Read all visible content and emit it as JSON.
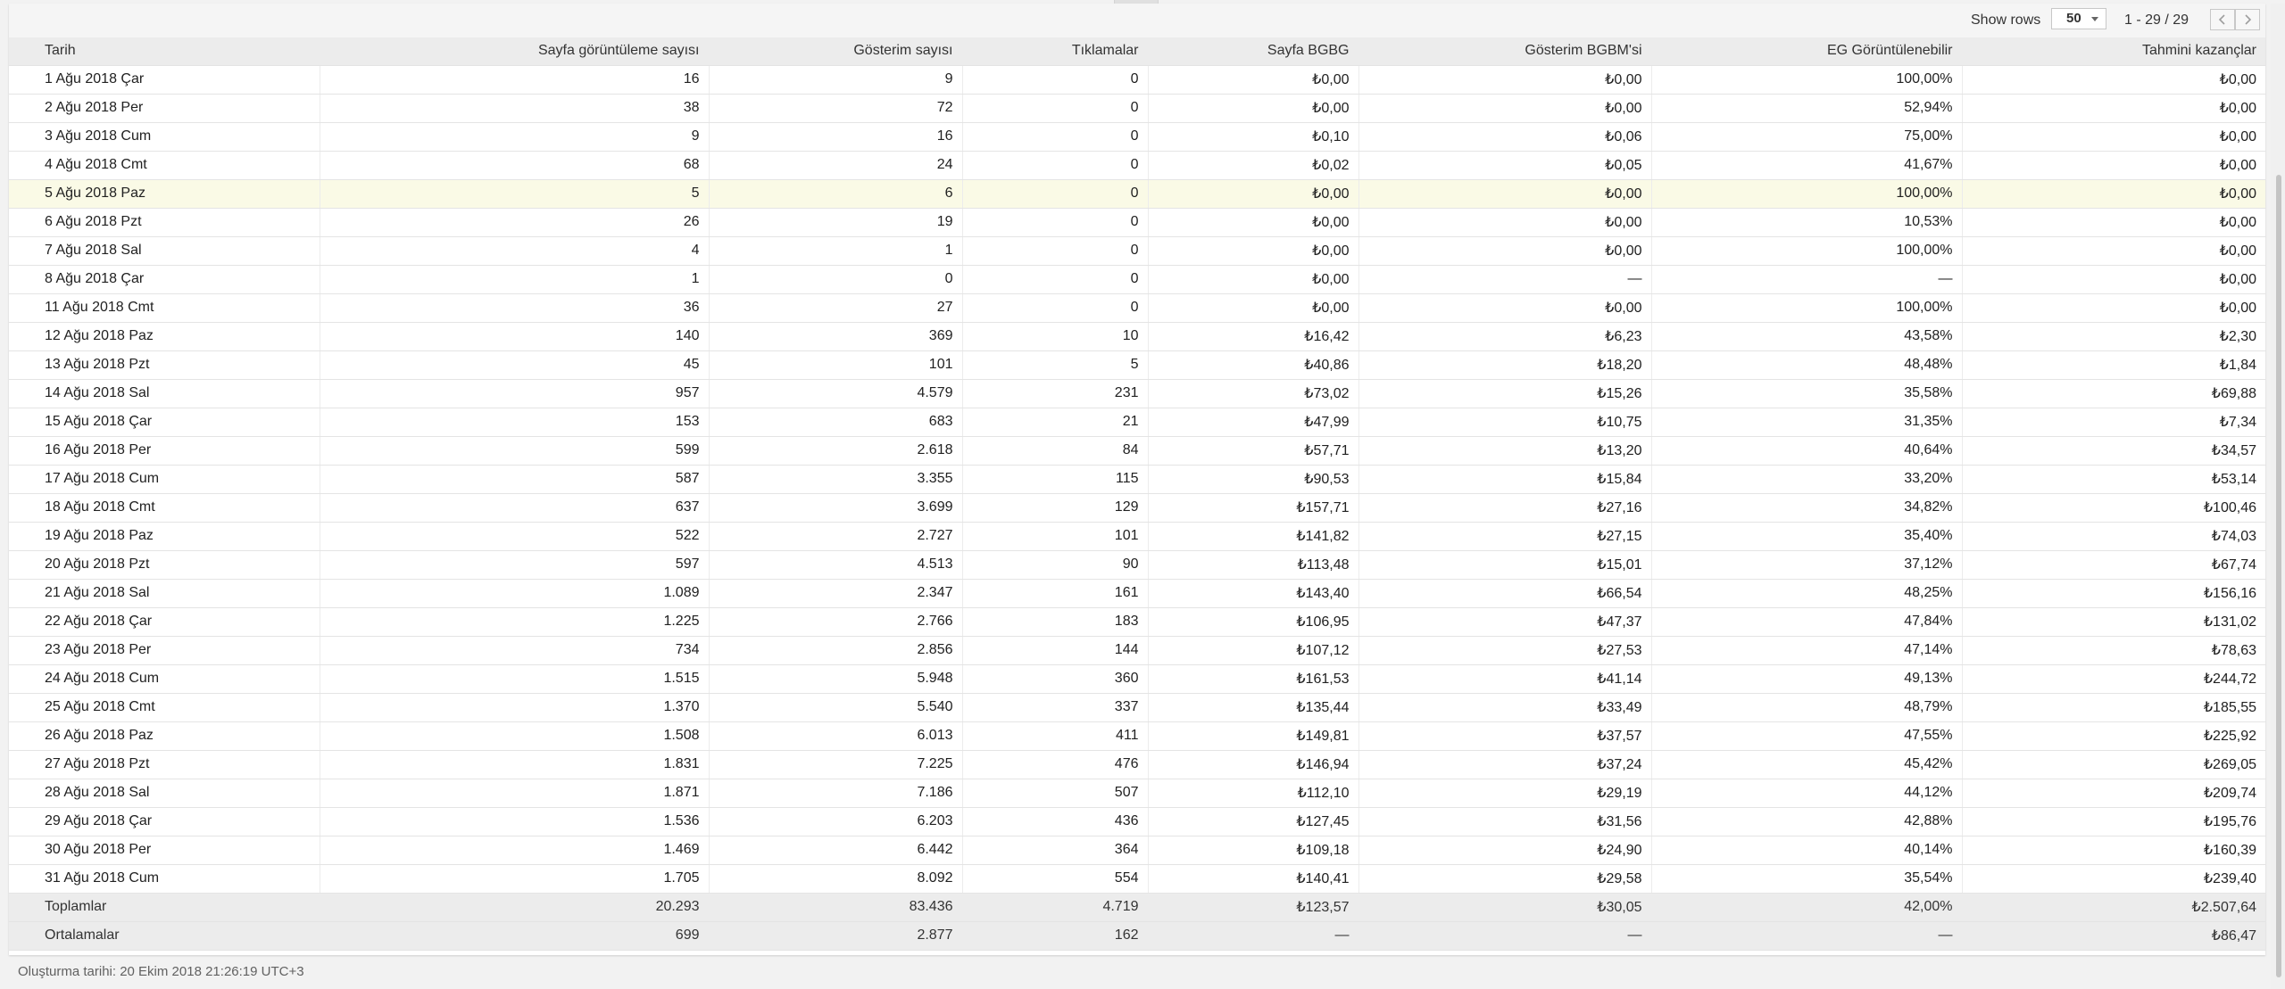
{
  "toolbar": {
    "show_rows_label": "Show rows",
    "rows_value": "50",
    "range": "1 - 29 / 29"
  },
  "columns": [
    "Tarih",
    "Sayfa görüntüleme sayısı",
    "Gösterim sayısı",
    "Tıklamalar",
    "Sayfa BGBG",
    "Gösterim BGBM'si",
    "EG Görüntülenebilir",
    "Tahmini kazançlar"
  ],
  "rows": [
    [
      "1 Ağu 2018 Çar",
      "16",
      "9",
      "0",
      "₺0,00",
      "₺0,00",
      "100,00%",
      "₺0,00"
    ],
    [
      "2 Ağu 2018 Per",
      "38",
      "72",
      "0",
      "₺0,00",
      "₺0,00",
      "52,94%",
      "₺0,00"
    ],
    [
      "3 Ağu 2018 Cum",
      "9",
      "16",
      "0",
      "₺0,10",
      "₺0,06",
      "75,00%",
      "₺0,00"
    ],
    [
      "4 Ağu 2018 Cmt",
      "68",
      "24",
      "0",
      "₺0,02",
      "₺0,05",
      "41,67%",
      "₺0,00"
    ],
    [
      "5 Ağu 2018 Paz",
      "5",
      "6",
      "0",
      "₺0,00",
      "₺0,00",
      "100,00%",
      "₺0,00"
    ],
    [
      "6 Ağu 2018 Pzt",
      "26",
      "19",
      "0",
      "₺0,00",
      "₺0,00",
      "10,53%",
      "₺0,00"
    ],
    [
      "7 Ağu 2018 Sal",
      "4",
      "1",
      "0",
      "₺0,00",
      "₺0,00",
      "100,00%",
      "₺0,00"
    ],
    [
      "8 Ağu 2018 Çar",
      "1",
      "0",
      "0",
      "₺0,00",
      "—",
      "—",
      "₺0,00"
    ],
    [
      "11 Ağu 2018 Cmt",
      "36",
      "27",
      "0",
      "₺0,00",
      "₺0,00",
      "100,00%",
      "₺0,00"
    ],
    [
      "12 Ağu 2018 Paz",
      "140",
      "369",
      "10",
      "₺16,42",
      "₺6,23",
      "43,58%",
      "₺2,30"
    ],
    [
      "13 Ağu 2018 Pzt",
      "45",
      "101",
      "5",
      "₺40,86",
      "₺18,20",
      "48,48%",
      "₺1,84"
    ],
    [
      "14 Ağu 2018 Sal",
      "957",
      "4.579",
      "231",
      "₺73,02",
      "₺15,26",
      "35,58%",
      "₺69,88"
    ],
    [
      "15 Ağu 2018 Çar",
      "153",
      "683",
      "21",
      "₺47,99",
      "₺10,75",
      "31,35%",
      "₺7,34"
    ],
    [
      "16 Ağu 2018 Per",
      "599",
      "2.618",
      "84",
      "₺57,71",
      "₺13,20",
      "40,64%",
      "₺34,57"
    ],
    [
      "17 Ağu 2018 Cum",
      "587",
      "3.355",
      "115",
      "₺90,53",
      "₺15,84",
      "33,20%",
      "₺53,14"
    ],
    [
      "18 Ağu 2018 Cmt",
      "637",
      "3.699",
      "129",
      "₺157,71",
      "₺27,16",
      "34,82%",
      "₺100,46"
    ],
    [
      "19 Ağu 2018 Paz",
      "522",
      "2.727",
      "101",
      "₺141,82",
      "₺27,15",
      "35,40%",
      "₺74,03"
    ],
    [
      "20 Ağu 2018 Pzt",
      "597",
      "4.513",
      "90",
      "₺113,48",
      "₺15,01",
      "37,12%",
      "₺67,74"
    ],
    [
      "21 Ağu 2018 Sal",
      "1.089",
      "2.347",
      "161",
      "₺143,40",
      "₺66,54",
      "48,25%",
      "₺156,16"
    ],
    [
      "22 Ağu 2018 Çar",
      "1.225",
      "2.766",
      "183",
      "₺106,95",
      "₺47,37",
      "47,84%",
      "₺131,02"
    ],
    [
      "23 Ağu 2018 Per",
      "734",
      "2.856",
      "144",
      "₺107,12",
      "₺27,53",
      "47,14%",
      "₺78,63"
    ],
    [
      "24 Ağu 2018 Cum",
      "1.515",
      "5.948",
      "360",
      "₺161,53",
      "₺41,14",
      "49,13%",
      "₺244,72"
    ],
    [
      "25 Ağu 2018 Cmt",
      "1.370",
      "5.540",
      "337",
      "₺135,44",
      "₺33,49",
      "48,79%",
      "₺185,55"
    ],
    [
      "26 Ağu 2018 Paz",
      "1.508",
      "6.013",
      "411",
      "₺149,81",
      "₺37,57",
      "47,55%",
      "₺225,92"
    ],
    [
      "27 Ağu 2018 Pzt",
      "1.831",
      "7.225",
      "476",
      "₺146,94",
      "₺37,24",
      "45,42%",
      "₺269,05"
    ],
    [
      "28 Ağu 2018 Sal",
      "1.871",
      "7.186",
      "507",
      "₺112,10",
      "₺29,19",
      "44,12%",
      "₺209,74"
    ],
    [
      "29 Ağu 2018 Çar",
      "1.536",
      "6.203",
      "436",
      "₺127,45",
      "₺31,56",
      "42,88%",
      "₺195,76"
    ],
    [
      "30 Ağu 2018 Per",
      "1.469",
      "6.442",
      "364",
      "₺109,18",
      "₺24,90",
      "40,14%",
      "₺160,39"
    ],
    [
      "31 Ağu 2018 Cum",
      "1.705",
      "8.092",
      "554",
      "₺140,41",
      "₺29,58",
      "35,54%",
      "₺239,40"
    ]
  ],
  "highlighted_row": 4,
  "summary_rows": [
    [
      "Toplamlar",
      "20.293",
      "83.436",
      "4.719",
      "₺123,57",
      "₺30,05",
      "42,00%",
      "₺2.507,64"
    ],
    [
      "Ortalamalar",
      "699",
      "2.877",
      "162",
      "—",
      "—",
      "—",
      "₺86,47"
    ]
  ],
  "footer": {
    "created": "Oluşturma tarihi: 20 Ekim 2018 21:26:19 UTC+3"
  },
  "colors": {
    "header_bg": "#ececec",
    "highlight_row_bg": "#fafae6",
    "page_bg": "#f2f2f2"
  },
  "icons": {
    "prev": "chevron-left-icon",
    "next": "chevron-right-icon",
    "select_caret": "caret-down-icon"
  }
}
